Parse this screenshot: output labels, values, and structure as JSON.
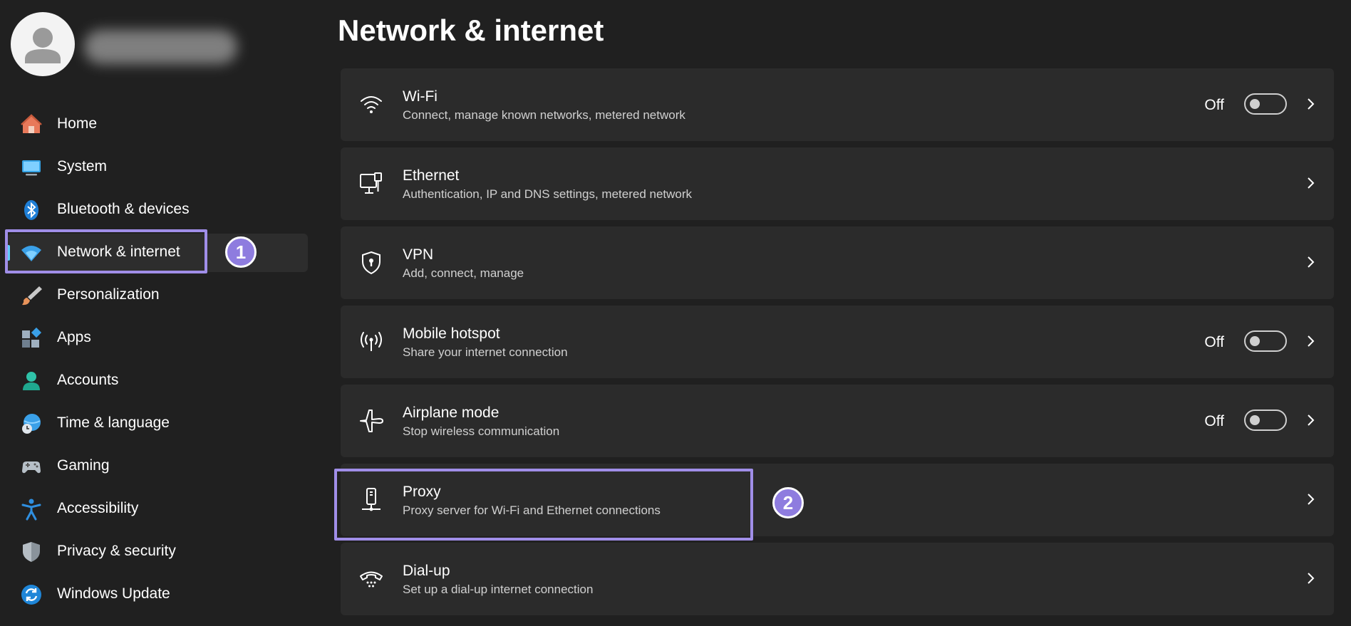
{
  "page_title": "Network & internet",
  "sidebar": {
    "items": [
      {
        "label": "Home",
        "icon": "home-icon"
      },
      {
        "label": "System",
        "icon": "system-icon"
      },
      {
        "label": "Bluetooth & devices",
        "icon": "bluetooth-icon"
      },
      {
        "label": "Network & internet",
        "icon": "network-icon",
        "selected": true
      },
      {
        "label": "Personalization",
        "icon": "brush-icon"
      },
      {
        "label": "Apps",
        "icon": "apps-icon"
      },
      {
        "label": "Accounts",
        "icon": "accounts-icon"
      },
      {
        "label": "Time & language",
        "icon": "globe-clock-icon"
      },
      {
        "label": "Gaming",
        "icon": "gamepad-icon"
      },
      {
        "label": "Accessibility",
        "icon": "accessibility-icon"
      },
      {
        "label": "Privacy & security",
        "icon": "shield-icon"
      },
      {
        "label": "Windows Update",
        "icon": "update-icon"
      }
    ]
  },
  "cards": [
    {
      "title": "Wi-Fi",
      "subtitle": "Connect, manage known networks, metered network",
      "icon": "wifi-icon",
      "state": "Off",
      "toggle_on": false
    },
    {
      "title": "Ethernet",
      "subtitle": "Authentication, IP and DNS settings, metered network",
      "icon": "ethernet-icon"
    },
    {
      "title": "VPN",
      "subtitle": "Add, connect, manage",
      "icon": "vpn-shield-icon"
    },
    {
      "title": "Mobile hotspot",
      "subtitle": "Share your internet connection",
      "icon": "hotspot-icon",
      "state": "Off",
      "toggle_on": false
    },
    {
      "title": "Airplane mode",
      "subtitle": "Stop wireless communication",
      "icon": "airplane-icon",
      "state": "Off",
      "toggle_on": false
    },
    {
      "title": "Proxy",
      "subtitle": "Proxy server for Wi-Fi and Ethernet connections",
      "icon": "proxy-icon"
    },
    {
      "title": "Dial-up",
      "subtitle": "Set up a dial-up internet connection",
      "icon": "dialup-icon"
    }
  ],
  "annotations": {
    "step1": "1",
    "step2": "2"
  },
  "colors": {
    "background": "#202020",
    "card": "#2b2b2b",
    "accent": "#60cdff",
    "highlight": "#a08ee8",
    "badge": "#8e7cdf"
  }
}
